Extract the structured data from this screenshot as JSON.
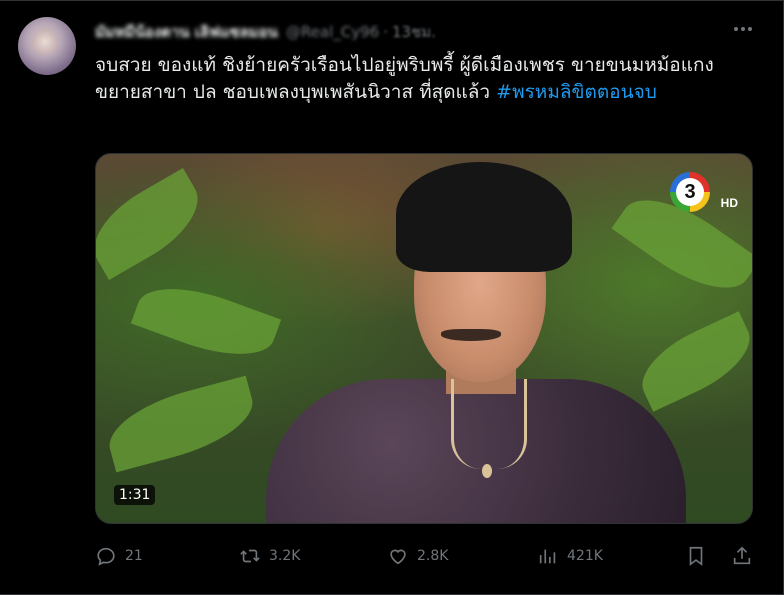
{
  "tweet": {
    "display_name": "มัมหมีน้องตาน เลิฟแซลมอน",
    "handle": "@Real_Cy96",
    "separator": "·",
    "time": "13ชม.",
    "text_main": "จบสวย ของแท้ ชิงย้ายครัวเรือนไปอยู่พริบพรี้ ผู้ดีเมืองเพชร ขายขนมหม้อแกงขยายสาขา ปล ชอบเพลงบุพเพสันนิวาส ที่สุดแล้ว ",
    "hashtag": "#พรหมลิขิตตอนจบ"
  },
  "media": {
    "duration": "1:31",
    "channel_number": "3",
    "channel_hd": "HD"
  },
  "actions": {
    "reply_count": "21",
    "retweet_count": "3.2K",
    "like_count": "2.8K",
    "views_count": "421K"
  },
  "icons": [
    "more-icon",
    "reply-icon",
    "retweet-icon",
    "like-icon",
    "views-icon",
    "bookmark-icon",
    "share-icon"
  ],
  "colors": {
    "background": "#000000",
    "text": "#e7e9ea",
    "muted": "#71767b",
    "accent": "#1d9bf0"
  }
}
